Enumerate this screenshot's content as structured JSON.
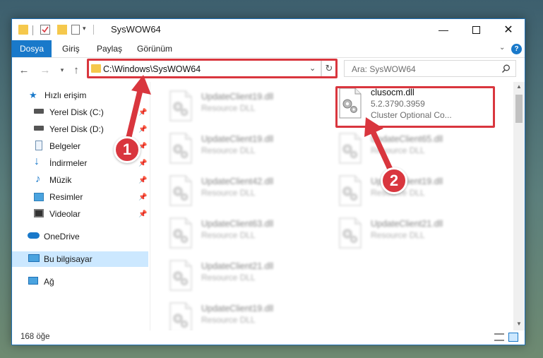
{
  "window": {
    "title": "SysWOW64",
    "controls": [
      "minimize-icon",
      "maximize-icon",
      "close-icon"
    ]
  },
  "ribbon": {
    "tabs": [
      {
        "label": "Dosya",
        "active": true
      },
      {
        "label": "Giriş"
      },
      {
        "label": "Paylaş"
      },
      {
        "label": "Görünüm"
      }
    ],
    "help": "?"
  },
  "address": {
    "path": "C:\\Windows\\SysWOW64",
    "search_placeholder": "Ara: SysWOW64"
  },
  "sidebar": {
    "items": [
      {
        "label": "Hızlı erişim",
        "icon": "star-icon"
      },
      {
        "label": "Yerel Disk (C:)",
        "icon": "drive-icon",
        "pinned": true
      },
      {
        "label": "Yerel Disk (D:)",
        "icon": "drive-icon",
        "pinned": true
      },
      {
        "label": "Belgeler",
        "icon": "documents-icon",
        "pinned": true
      },
      {
        "label": "İndirmeler",
        "icon": "download-icon",
        "pinned": true
      },
      {
        "label": "Müzik",
        "icon": "music-icon",
        "pinned": true
      },
      {
        "label": "Resimler",
        "icon": "pictures-icon",
        "pinned": true
      },
      {
        "label": "Videolar",
        "icon": "videos-icon",
        "pinned": true
      },
      {
        "label": "OneDrive",
        "icon": "cloud-icon"
      },
      {
        "label": "Bu bilgisayar",
        "icon": "computer-icon",
        "selected": true
      },
      {
        "label": "Ağ",
        "icon": "network-icon"
      }
    ]
  },
  "files": [
    {
      "name": "UpdateClient19.dll",
      "type": "Resource DLL"
    },
    {
      "name": "clusocm.dll",
      "version": "5.2.3790.3959",
      "desc": "Cluster Optional Co...",
      "highlighted": true
    },
    {
      "name": "UpdateClient19.dll",
      "type": "Resource DLL"
    },
    {
      "name": "UpdateClient65.dll",
      "type": "Resource DLL"
    },
    {
      "name": "UpdateClient42.dll",
      "type": "Resource DLL"
    },
    {
      "name": "UpdateClient19.dll",
      "type": "Resource DLL"
    },
    {
      "name": "UpdateClient63.dll",
      "type": "Resource DLL"
    },
    {
      "name": "UpdateClient21.dll",
      "type": "Resource DLL"
    },
    {
      "name": "UpdateClient21.dll",
      "type": "Resource DLL"
    },
    {
      "name": "UpdateClient19.dll",
      "type": "Resource DLL"
    }
  ],
  "status": {
    "count": "168 öğe"
  },
  "annotations": {
    "step1": "1",
    "step2": "2",
    "color": "#d9363e"
  }
}
